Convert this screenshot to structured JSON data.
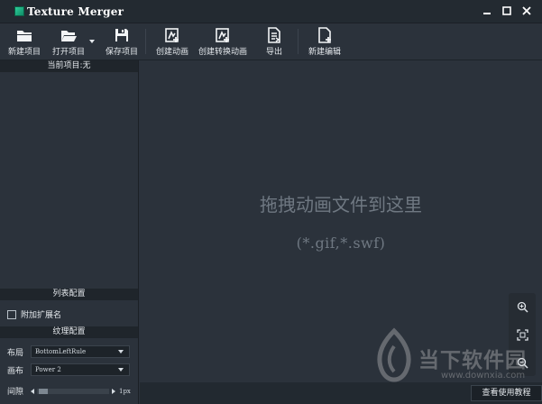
{
  "window": {
    "title": "Texture Merger",
    "controls": {
      "minimize": "▬",
      "maximize": "■",
      "close": "✕"
    }
  },
  "toolbar": {
    "new_project": "新建项目",
    "open_project": "打开项目",
    "save_project": "保存项目",
    "create_animation": "创建动画",
    "create_convert_animation": "创建转换动画",
    "export": "导出",
    "new_edit": "新建编辑"
  },
  "left_panel": {
    "current_project": "当前项目:无",
    "list_settings": "列表配置",
    "append_ext_label": "附加扩展名",
    "append_ext_checked": false,
    "texture_settings": "纹理配置",
    "layout_label": "布局",
    "layout_value": "BottomLeftRule",
    "canvas_label": "画布",
    "canvas_value": "Power 2",
    "gap_label": "间隙",
    "gap_value": "1px"
  },
  "canvas": {
    "drop_hint": "拖拽动画文件到这里",
    "drop_ext": "(*.gif,*.swf)",
    "help_button": "查看使用教程",
    "zoom_icons": [
      "zoom-in-icon",
      "fit-icon",
      "zoom-out-icon"
    ]
  },
  "watermark": {
    "brand": "当下软件园",
    "url": "www.downxia.com"
  },
  "colors": {
    "background": "#2b323b",
    "titlebar": "#232a31",
    "section_header": "#1f252b",
    "hint_text": "#6f7882",
    "logo": "#2ecf9a"
  }
}
